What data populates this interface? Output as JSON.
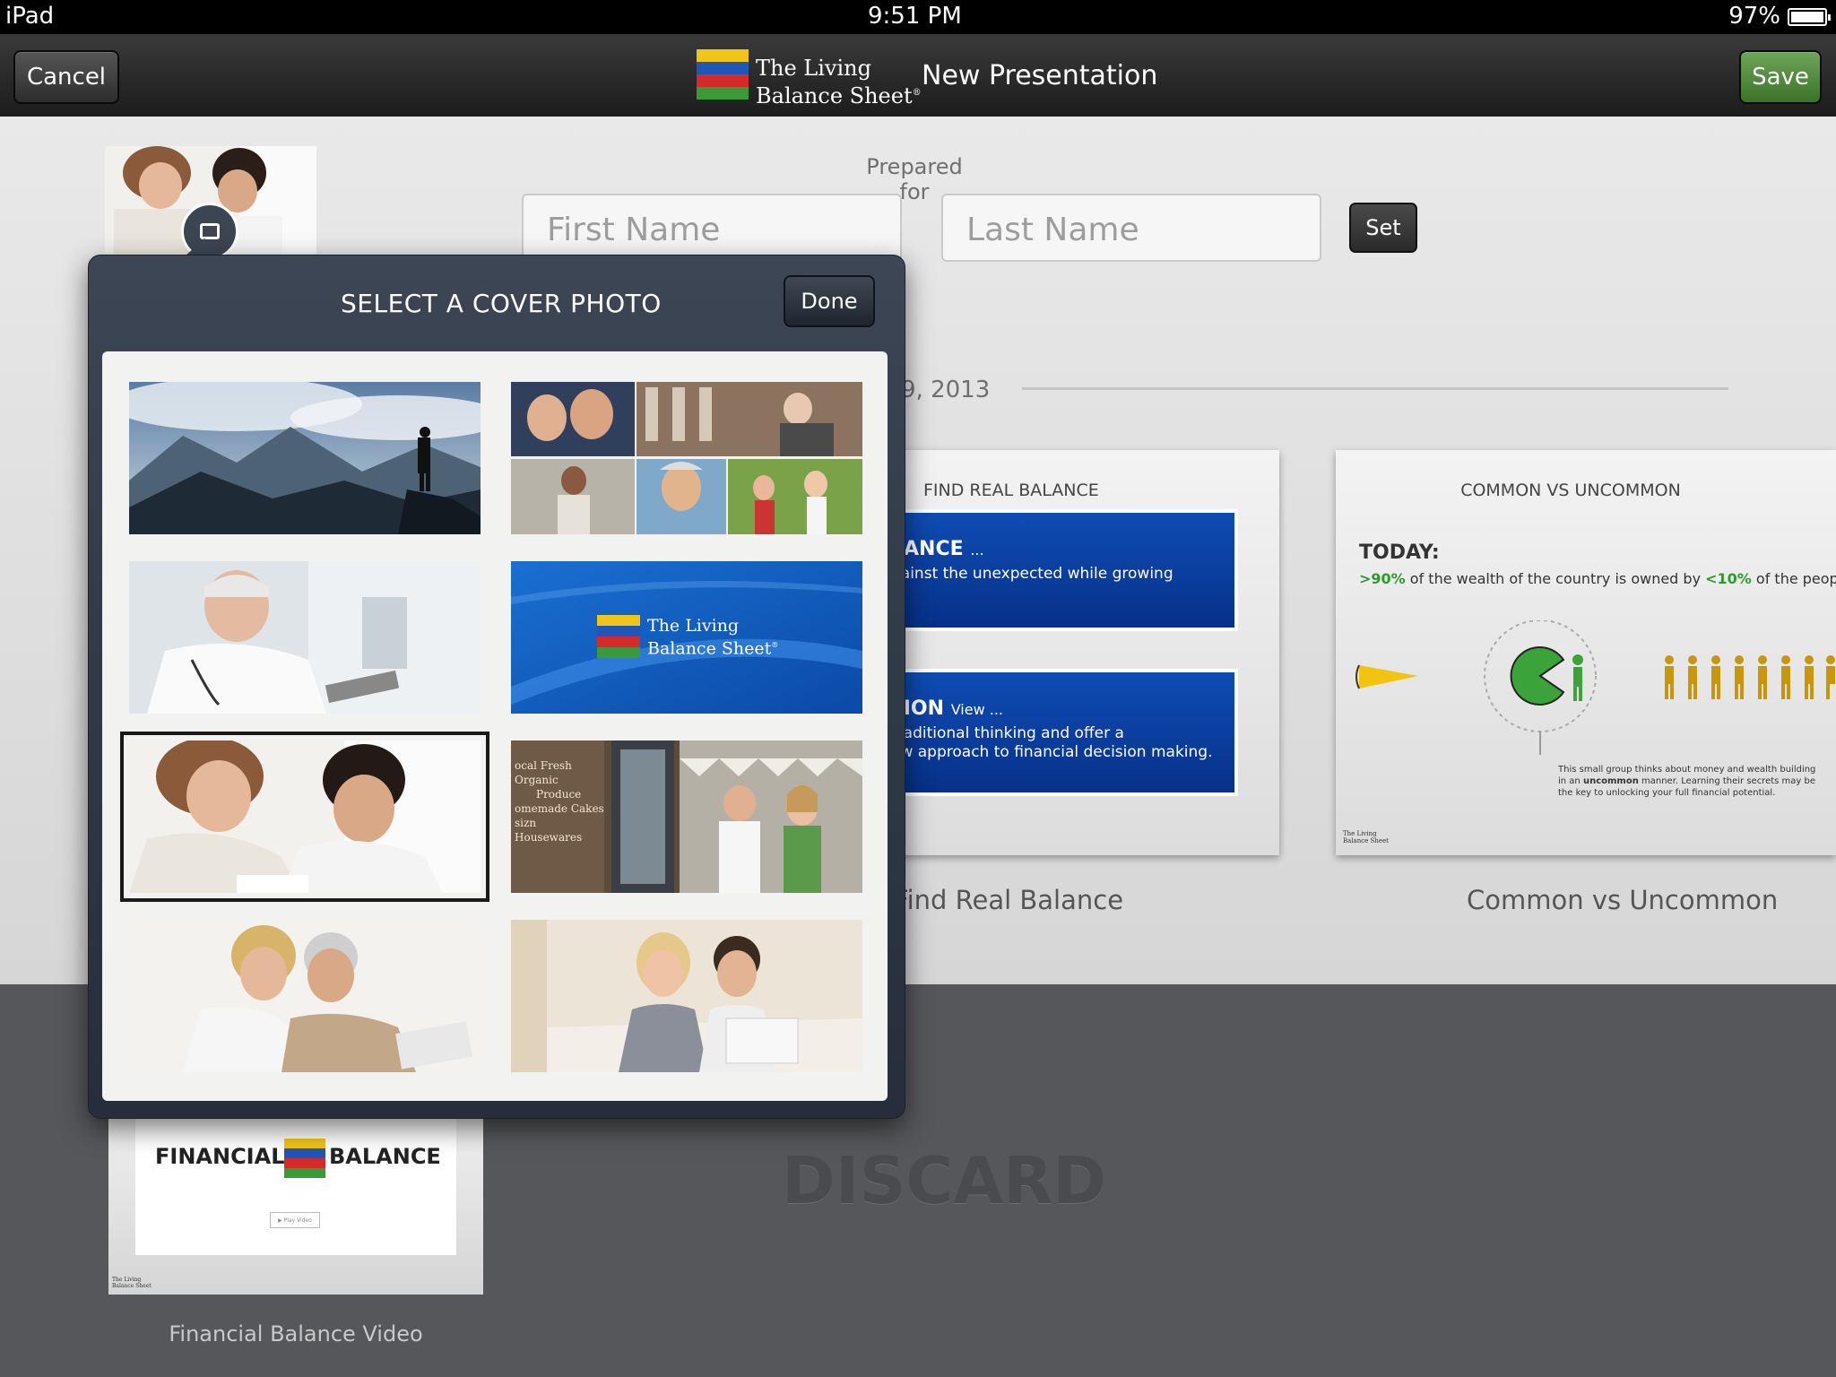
{
  "status_bar": {
    "device": "iPad",
    "time": "9:51 PM",
    "battery": "97%"
  },
  "nav": {
    "cancel_label": "Cancel",
    "brand_line1": "The Living",
    "brand_line2": "Balance Sheet",
    "brand_reg": "®",
    "title": "New Presentation",
    "save_label": "Save"
  },
  "form": {
    "prepared_for": "Prepared for",
    "first_name_placeholder": "First Name",
    "last_name_placeholder": "Last Name",
    "set_label": "Set",
    "date_partial": "9, 2013"
  },
  "popover": {
    "title": "SELECT A COVER PHOTO",
    "done_label": "Done",
    "logo_line1": "The Living",
    "logo_line2": "Balance Sheet",
    "logo_reg": "®",
    "store_sign": [
      "ocal Fresh Organic",
      "Produce",
      "omemade Cakes",
      "sizn Housewares"
    ]
  },
  "slides": {
    "find_balance": {
      "title": "FIND REAL BALANCE",
      "panel1_heading": "LANCE",
      "panel1_ellipsis": "...",
      "panel1_text": "gainst the unexpected while growing",
      "panel2_heading": "MON",
      "panel2_view": "View ...",
      "panel2_line1": "traditional thinking and offer a",
      "panel2_line2": "ew approach to financial decision making.",
      "caption": "Find Real Balance"
    },
    "common": {
      "title": "COMMON VS UNCOMMON",
      "today": "TODAY:",
      "stat_a": ">90%",
      "stat_mid": " of the wealth of the country is owned by ",
      "stat_b": "<10%",
      "stat_end": " of the people",
      "note_line1": "This small group thinks about money and wealth building",
      "note_line2_a": "in an ",
      "note_line2_b": "uncommon",
      "note_line2_c": " manner. Learning their secrets may be",
      "note_line3": "the key to unlocking your full financial potential.",
      "logo_line1": "The Living",
      "logo_line2": "Balance Sheet",
      "caption": "Common vs Uncommon"
    },
    "video": {
      "word1": "FINANCIAL",
      "word2": "BALANCE",
      "play": "▶ Play Video",
      "logo_line1": "The Living",
      "logo_line2": "Balance Sheet",
      "caption": "Financial Balance Video"
    }
  },
  "discard_label": "DISCARD",
  "colors": {
    "save_green": "#4a8a36",
    "slide_blue": "#0a3f9f",
    "stat_green": "#2e9a2e",
    "figure_gold": "#c8960a",
    "pie_green": "#3aa33a"
  }
}
